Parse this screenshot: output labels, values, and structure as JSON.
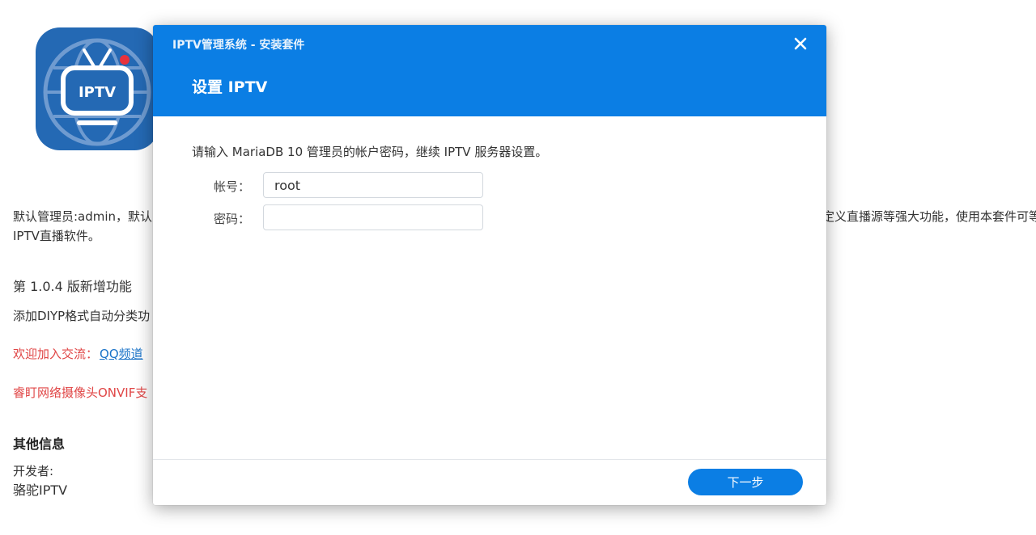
{
  "background": {
    "app_icon_label": "IPTV",
    "description_line1": "默认管理员:admin，默认",
    "description_right": "定义直播源等强大功能，使用本套件可等",
    "description_line2": "IPTV直播软件。",
    "version_heading": "第 1.0.4 版新增功能",
    "feature_text": "添加DIYP格式自动分类功",
    "join_text": "欢迎加入交流：",
    "join_link": "QQ频道",
    "camera_text": "睿盯网络摄像头ONVIF支",
    "other_info_heading": "其他信息",
    "developer_label": "开发者:",
    "developer_name": "骆驼IPTV"
  },
  "dialog": {
    "caption": "IPTV管理系统 - 安装套件",
    "title": "设置 IPTV",
    "instruction": "请输入 MariaDB 10 管理员的帐户密码，继续 IPTV 服务器设置。",
    "account_label": "帐号：",
    "account_value": "root",
    "password_label": "密码：",
    "password_value": "",
    "next_button": "下一步"
  },
  "colors": {
    "accent": "#0b7ee4",
    "icon_bg": "#2469b4",
    "alert_red": "#e04646",
    "link_blue": "#1a73c8"
  },
  "icons": {
    "close": "close-icon",
    "app": "iptv-app-icon"
  }
}
